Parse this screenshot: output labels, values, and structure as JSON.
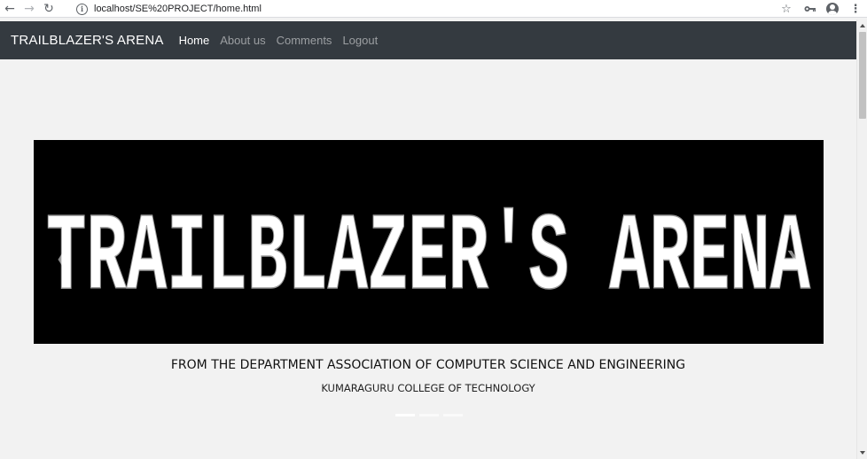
{
  "browser": {
    "url": "localhost/SE%20PROJECT/home.html",
    "back_icon": "arrow-left-icon",
    "forward_icon": "arrow-right-icon",
    "reload_icon": "reload-icon",
    "info_icon": "info-icon",
    "star_icon": "star-icon",
    "key_icon": "key-icon",
    "account_icon": "account-icon",
    "menu_icon": "more-vert-icon"
  },
  "navbar": {
    "brand": "TRAILBLAZER'S ARENA",
    "links": [
      {
        "label": "Home",
        "active": true
      },
      {
        "label": "About us",
        "active": false
      },
      {
        "label": "Comments",
        "active": false
      },
      {
        "label": "Logout",
        "active": false
      }
    ]
  },
  "carousel": {
    "banner_text": "TRAILBLAZER'S ARENA",
    "caption_title": "FROM THE DEPARTMENT ASSOCIATION OF COMPUTER SCIENCE AND ENGINEERING",
    "caption_subtitle": "KUMARAGURU COLLEGE OF TECHNOLOGY",
    "indicator_count": 3,
    "active_indicator": 0,
    "prev_icon": "chevron-left-icon",
    "next_icon": "chevron-right-icon"
  },
  "colors": {
    "navbar_bg": "#343a40",
    "page_bg": "#f2f2f2",
    "banner_bg": "#000000",
    "banner_text": "#ffffff"
  }
}
